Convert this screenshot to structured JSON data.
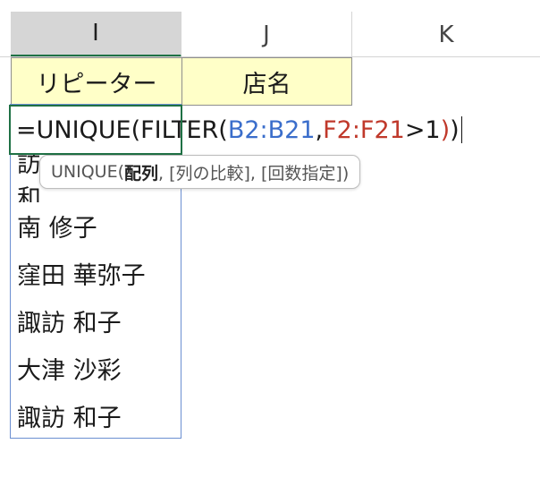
{
  "columns": [
    {
      "label": "I",
      "selected": true
    },
    {
      "label": "J",
      "selected": false
    },
    {
      "label": "K",
      "selected": false
    }
  ],
  "headers": {
    "col_i": "リピーター",
    "col_j": "店名"
  },
  "formula": {
    "prefix": "=UNIQUE(FILTER(",
    "ref1": "B2:B21",
    "comma": ",",
    "ref2": "F2:F21",
    "suffix": ">1",
    "close_inner": ")",
    "close_outer": ")"
  },
  "tooltip": {
    "func": "UNIQUE(",
    "arg1": "配列",
    "rest": ", [列の比較], [回数指定])"
  },
  "spill_values": [
    "諏訪 和子",
    "南 修子",
    "窪田 華弥子",
    "諏訪 和子",
    "大津 沙彩",
    "諏訪 和子"
  ],
  "colors": {
    "accent_green": "#1f7145",
    "header_fill": "#ffffc8",
    "ref_blue": "#3b6ecb",
    "ref_red": "#c0392b"
  }
}
